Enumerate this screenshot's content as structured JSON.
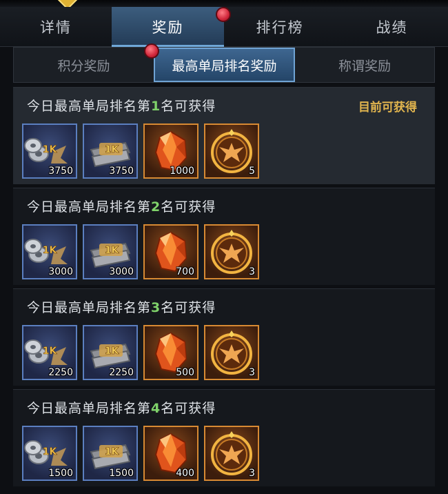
{
  "main_tabs": [
    {
      "label": "详情"
    },
    {
      "label": "奖励"
    },
    {
      "label": "排行榜"
    },
    {
      "label": "战绩"
    }
  ],
  "sub_tabs": [
    {
      "label": "积分奖励"
    },
    {
      "label": "最高单局排名奖励"
    },
    {
      "label": "称谓奖励"
    }
  ],
  "rewards": [
    {
      "title_prefix": "今日最高单局排名第",
      "rank": "1",
      "title_suffix": "名可获得",
      "status": "目前可获得",
      "items": [
        {
          "icon": "silver-coin-bundle-icon",
          "badge": "1K",
          "qty": "3750"
        },
        {
          "icon": "silver-ticket-bundle-icon",
          "badge": "1K",
          "qty": "3750"
        },
        {
          "icon": "orange-crystal-icon",
          "qty": "1000"
        },
        {
          "icon": "phoenix-emblem-icon",
          "qty": "5"
        }
      ]
    },
    {
      "title_prefix": "今日最高单局排名第",
      "rank": "2",
      "title_suffix": "名可获得",
      "status": "",
      "items": [
        {
          "icon": "silver-coin-bundle-icon",
          "badge": "1K",
          "qty": "3000"
        },
        {
          "icon": "silver-ticket-bundle-icon",
          "badge": "1K",
          "qty": "3000"
        },
        {
          "icon": "orange-crystal-icon",
          "qty": "700"
        },
        {
          "icon": "phoenix-emblem-icon",
          "qty": "3"
        }
      ]
    },
    {
      "title_prefix": "今日最高单局排名第",
      "rank": "3",
      "title_suffix": "名可获得",
      "status": "",
      "items": [
        {
          "icon": "silver-coin-bundle-icon",
          "badge": "1K",
          "qty": "2250"
        },
        {
          "icon": "silver-ticket-bundle-icon",
          "badge": "1K",
          "qty": "2250"
        },
        {
          "icon": "orange-crystal-icon",
          "qty": "500"
        },
        {
          "icon": "phoenix-emblem-icon",
          "qty": "3"
        }
      ]
    },
    {
      "title_prefix": "今日最高单局排名第",
      "rank": "4",
      "title_suffix": "名可获得",
      "status": "",
      "items": [
        {
          "icon": "silver-coin-bundle-icon",
          "badge": "1K",
          "qty": "1500"
        },
        {
          "icon": "silver-ticket-bundle-icon",
          "badge": "1K",
          "qty": "1500"
        },
        {
          "icon": "orange-crystal-icon",
          "qty": "400"
        },
        {
          "icon": "phoenix-emblem-icon",
          "qty": "3"
        }
      ]
    }
  ],
  "colors": {
    "accent_tab": "#3c5d7e",
    "rank_highlight": "#7fd26a",
    "status_gold": "#e2b54e",
    "item_border_blue": "#5b7fc0",
    "item_border_gold": "#d88a33",
    "notify_red": "#d0273b"
  }
}
